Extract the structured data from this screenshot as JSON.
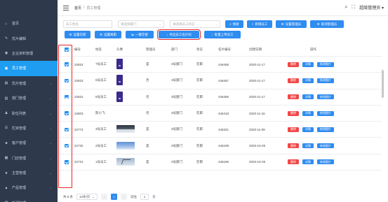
{
  "sidebar": {
    "items": [
      {
        "label": "首页",
        "icon": "home-icon",
        "glyph": "⌂"
      },
      {
        "label": "优片编辑",
        "icon": "edit-icon",
        "glyph": "✎"
      },
      {
        "label": "企业资料管理",
        "icon": "building-icon",
        "glyph": "◉"
      },
      {
        "label": "员工管理",
        "icon": "user-icon",
        "glyph": "▣",
        "active": true
      },
      {
        "label": "优片管理",
        "icon": "image-icon",
        "glyph": "▤"
      },
      {
        "label": "部门管理",
        "icon": "dept-icon",
        "glyph": "▥"
      },
      {
        "label": "职位列表",
        "icon": "org-icon",
        "glyph": "♟"
      },
      {
        "label": "栏目管理",
        "icon": "list-icon",
        "glyph": "☰"
      },
      {
        "label": "客户管理",
        "icon": "customer-icon",
        "glyph": "♣"
      },
      {
        "label": "门店管理",
        "icon": "store-icon",
        "glyph": "▦"
      },
      {
        "label": "主营管理",
        "icon": "star-icon",
        "glyph": "★"
      },
      {
        "label": "产品管理",
        "icon": "cart-icon",
        "glyph": "▲"
      },
      {
        "label": "新闻管理",
        "icon": "news-icon",
        "glyph": "▧"
      }
    ]
  },
  "header": {
    "breadcrumb_home": "首页",
    "breadcrumb_sep": "/",
    "breadcrumb_current": "员工管理",
    "username": "超级管理员",
    "user_caret": "▾"
  },
  "filters": {
    "name_placeholder": "员工姓名",
    "dept_placeholder": "请选择部门",
    "status_placeholder": "请选择员工状态",
    "search_label": "搜索",
    "add_label": "新增员工",
    "set_mgr_label": "设置管理员",
    "cancel_mgr_label": "取消管理员",
    "set_active_label": "设置在职",
    "set_resign_label": "设置离职",
    "one_click_label": "一键交接",
    "export_label": "导出员工名片码",
    "batch_upload_label": "批量上传员工"
  },
  "table": {
    "headers": {
      "no": "编号",
      "name": "姓名",
      "avatar": "头像",
      "manager": "管理员",
      "dept": "部门",
      "status": "状态",
      "card_no": "名片编号",
      "created": "创建日期",
      "ops": "操作"
    },
    "rows": [
      {
        "no": "22824",
        "name": "7号员工",
        "avatar": "dark",
        "manager": "是",
        "dept": "3号部门",
        "status": "在职",
        "card_no": "446458",
        "created": "2020-11-17"
      },
      {
        "no": "22823",
        "name": "6号员工",
        "avatar": "dark",
        "manager": "否",
        "dept": "3号部门",
        "status": "在职",
        "card_no": "446457",
        "created": "2020-11-17"
      },
      {
        "no": "22822",
        "name": "5号员工",
        "avatar": "dark",
        "manager": "否",
        "dept": "3号部门",
        "status": "在职",
        "card_no": "446456",
        "created": "2020-11-17"
      },
      {
        "no": "22803",
        "name": "陈小飞",
        "avatar": "none",
        "manager": "否",
        "dept": "3号部门",
        "status": "在职",
        "card_no": "446418",
        "created": "2020-11-16"
      },
      {
        "no": "22774",
        "name": "3号员工",
        "avatar": "landscape",
        "manager": "是",
        "dept": "3号部门",
        "status": "在职",
        "card_no": "446321",
        "created": "2020-11-09"
      },
      {
        "no": "22732",
        "name": "2号员工",
        "avatar": "sky",
        "manager": "是",
        "dept": "3号部门",
        "status": "在职",
        "card_no": "446198",
        "created": "2020-10-29"
      },
      {
        "no": "22731",
        "name": "1号员工",
        "avatar": "bird",
        "manager": "是",
        "dept": "3号部门",
        "status": "在职",
        "card_no": "446196",
        "created": "2020-10-29"
      }
    ],
    "op_delete": "删除",
    "op_detail": "详情",
    "op_photo": "修改图片"
  },
  "pager": {
    "total": "共 8 条",
    "page_size": "10条/页",
    "current_page": "1",
    "goto_label": "前往",
    "goto_value": "1",
    "page_unit": "页"
  },
  "colors": {
    "sidebar_bg": "#2e3a4b",
    "accent": "#2f8cf0",
    "danger": "#f04848",
    "highlight_box": "#ee2222"
  }
}
